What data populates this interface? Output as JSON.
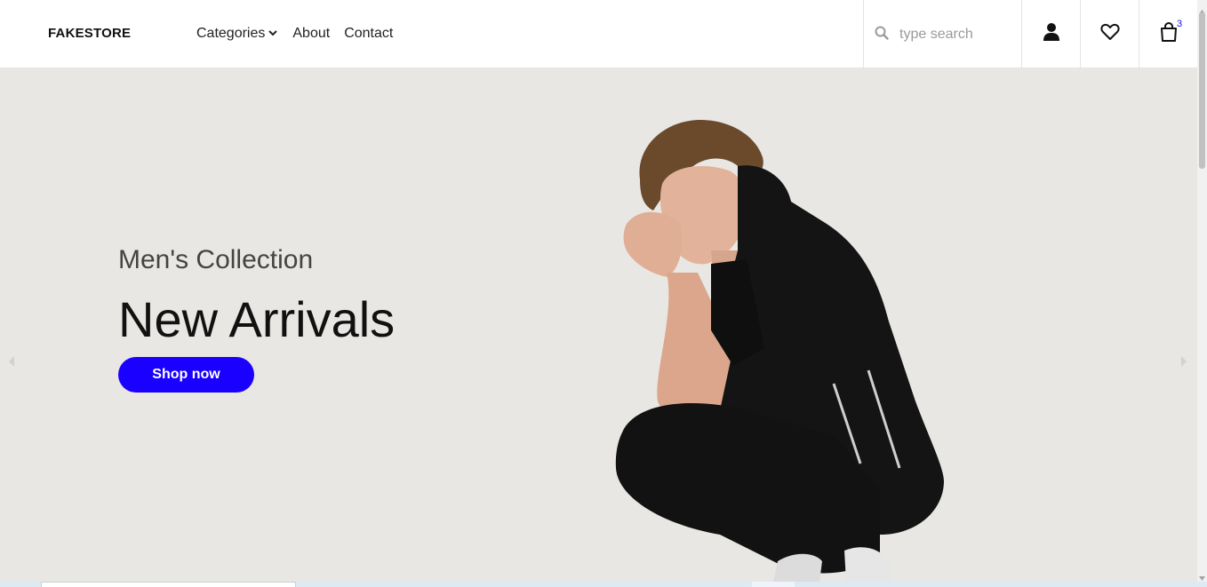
{
  "header": {
    "logo": "FAKESTORE",
    "nav": [
      {
        "label": "Categories",
        "has_dropdown": true
      },
      {
        "label": "About"
      },
      {
        "label": "Contact"
      }
    ],
    "search": {
      "placeholder": "type search",
      "value": ""
    },
    "icons": [
      "user-icon",
      "heart-icon",
      "cart-icon"
    ],
    "cart_count": "3"
  },
  "hero": {
    "subtitle": "Men's Collection",
    "title": "New Arrivals",
    "cta_label": "Shop now"
  },
  "colors": {
    "accent": "#1a00ff",
    "hero_bg": "#e8e7e3",
    "cart_count": "#1a12e6"
  }
}
